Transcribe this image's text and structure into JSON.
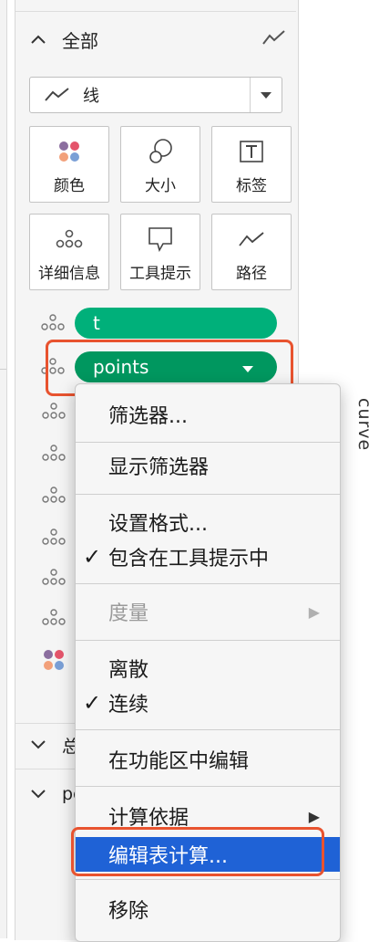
{
  "marks": {
    "all_label": "全部",
    "mark_type": "线",
    "cards": [
      {
        "label": "颜色",
        "icon": "color-dots-icon"
      },
      {
        "label": "大小",
        "icon": "size-circles-icon"
      },
      {
        "label": "标签",
        "icon": "text-label-icon"
      },
      {
        "label": "详细信息",
        "icon": "detail-dots-icon"
      },
      {
        "label": "工具提示",
        "icon": "tooltip-icon"
      },
      {
        "label": "路径",
        "icon": "path-line-icon"
      }
    ],
    "pills": [
      {
        "label": "t",
        "color": "#00b07a"
      },
      {
        "label": "points",
        "color": "#00975f"
      }
    ],
    "collapsed_sections": [
      {
        "label": "总"
      },
      {
        "label": "poin"
      }
    ]
  },
  "side_label": "curve",
  "context_menu": {
    "items": [
      {
        "label": "筛选器..."
      },
      {
        "label": "显示筛选器"
      },
      {
        "label": "设置格式..."
      },
      {
        "label": "包含在工具提示中",
        "checked": true
      },
      {
        "label": "度量",
        "disabled": true,
        "submenu": true
      },
      {
        "label": "离散"
      },
      {
        "label": "连续",
        "checked": true
      },
      {
        "label": "在功能区中编辑"
      },
      {
        "label": "计算依据",
        "submenu": true
      },
      {
        "label": "编辑表计算...",
        "highlighted": true
      },
      {
        "label": "移除"
      }
    ]
  },
  "colors": {
    "highlight_border": "#e8532f",
    "selection": "#1f62d6",
    "pill_green": "#00975f"
  }
}
